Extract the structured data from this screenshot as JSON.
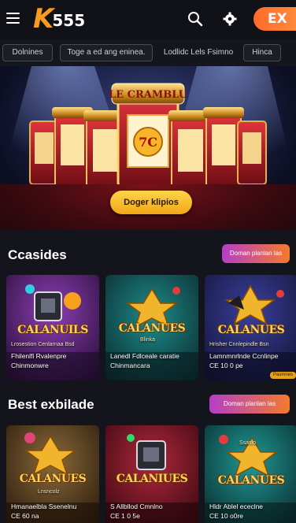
{
  "header": {
    "logo_k": "K",
    "logo_num": "555",
    "ex_label": "EX"
  },
  "chips": [
    "Dolnines",
    "Toge a ed ang eninea.",
    "Lodlidc Lels Fsimno",
    "Hinca"
  ],
  "hero": {
    "button_label": "Doger klipios",
    "sign_text": "LE CRAMBLU"
  },
  "sections": [
    {
      "title": "Ccasides",
      "more_label": "Doman planlan las",
      "cards": [
        {
          "logo": "CALANUILS",
          "subtitle": "Lrosestion Cenlarnaa Bsd",
          "line1": "Fhilenlfi Rvalenpre",
          "line2": "Chinmonwre",
          "badge": ""
        },
        {
          "logo": "CALANUES",
          "subtitle": "Blinka",
          "line1": "Lanedl Fdlceale caratie",
          "line2": "Chinmancara",
          "badge": ""
        },
        {
          "logo": "CALANUES",
          "subtitle": "Hrisher Cnnlepindle Bsn",
          "line1": "Lamnmnrlnde Ccnlinpe",
          "line2": "CE 10 0 pe",
          "badge": "Pasmnes"
        }
      ]
    },
    {
      "title": "Best exbilade",
      "more_label": "Doman planlan las",
      "cards": [
        {
          "logo": "CALANUES",
          "subtitle": "Lnsncolz",
          "line1": "Hmanaelbla Ssenelnu",
          "line2": "CE 60 na",
          "badge": ""
        },
        {
          "logo": "CALANIUES",
          "subtitle": "",
          "line1": "S Allbllod Cmnlno",
          "line2": "CE 1 0 5e",
          "badge": ""
        },
        {
          "logo": "CALANUES",
          "subtitle": "Ssaslo",
          "line1": "Hldr Ablel ececlne",
          "line2": "CE 10 o0re",
          "badge": ""
        }
      ]
    }
  ],
  "colors": {
    "accent_orange": "#f79a1e",
    "gradient_start": "#b43fc8",
    "gradient_end": "#f47a2c",
    "hero_button": "#ffc533"
  }
}
